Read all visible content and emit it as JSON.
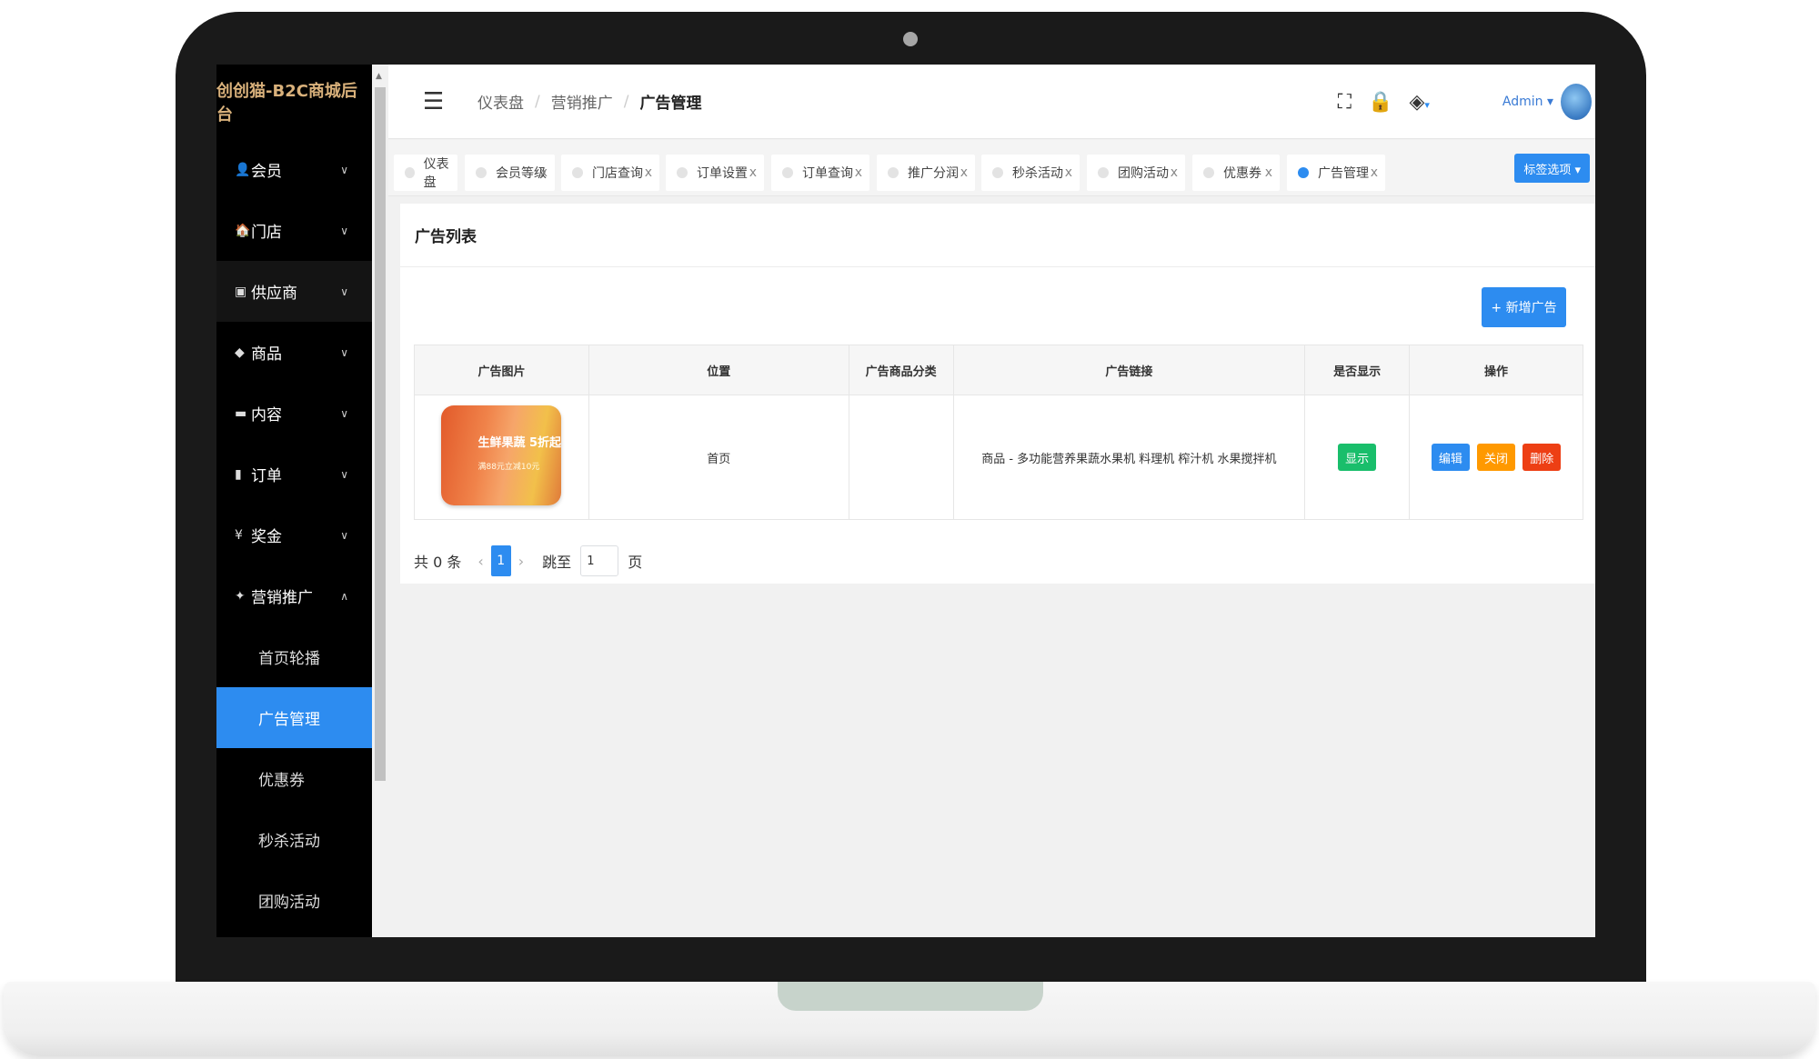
{
  "app": {
    "brand": "创创猫-B2C商城后台"
  },
  "sidebar": {
    "items": [
      {
        "icon": "user-icon",
        "glyph": "👤",
        "label": "会员",
        "arrow": "∨"
      },
      {
        "icon": "store-icon",
        "glyph": "🏠",
        "label": "门店",
        "arrow": "∨"
      },
      {
        "icon": "supplier-icon",
        "glyph": "▣",
        "label": "供应商",
        "arrow": "∨"
      },
      {
        "icon": "tag-icon",
        "glyph": "◆",
        "label": "商品",
        "arrow": "∨"
      },
      {
        "icon": "folder-icon",
        "glyph": "▬",
        "label": "内容",
        "arrow": "∨"
      },
      {
        "icon": "order-icon",
        "glyph": "▮",
        "label": "订单",
        "arrow": "∨"
      },
      {
        "icon": "yen-icon",
        "glyph": "¥",
        "label": "奖金",
        "arrow": "∨"
      },
      {
        "icon": "gamepad-icon",
        "glyph": "✦",
        "label": "营销推广",
        "arrow": "∧"
      }
    ],
    "sub_items": [
      "首页轮播",
      "广告管理",
      "优惠券",
      "秒杀活动",
      "团购活动"
    ]
  },
  "header": {
    "breadcrumb": [
      "仪表盘",
      "营销推广",
      "广告管理"
    ],
    "user": "Admin ▾"
  },
  "tabs": {
    "items": [
      {
        "label": "仪表盘",
        "closable": false
      },
      {
        "label": "会员等级",
        "closable": true
      },
      {
        "label": "门店查询",
        "closable": true
      },
      {
        "label": "订单设置",
        "closable": true
      },
      {
        "label": "订单查询",
        "closable": true
      },
      {
        "label": "推广分润",
        "closable": true
      },
      {
        "label": "秒杀活动",
        "closable": true
      },
      {
        "label": "团购活动",
        "closable": true
      },
      {
        "label": "优惠券",
        "closable": true
      },
      {
        "label": "广告管理",
        "closable": true
      }
    ],
    "close": "x",
    "options_label": "标签选项 ▾"
  },
  "card": {
    "title": "广告列表",
    "add_button": "+ 新增广告"
  },
  "table": {
    "headers": [
      "广告图片",
      "位置",
      "广告商品分类",
      "广告链接",
      "是否显示",
      "操作"
    ],
    "rows": [
      {
        "image_text": "生鲜果蔬 5折起",
        "image_subtext": "满88元立减10元",
        "position": "首页",
        "category": "",
        "link": "商品 - 多功能营养果蔬水果机 料理机 榨汁机 水果搅拌机",
        "display": "显示",
        "actions": [
          "编辑",
          "关闭",
          "删除"
        ]
      }
    ]
  },
  "pager": {
    "total": "共 0 条",
    "prev": "‹",
    "current": "1",
    "next": "›",
    "jump_label": "跳至",
    "jump_value": "1",
    "page_suffix": "页"
  },
  "colors": {
    "primary": "#2d8cf0",
    "success": "#19be6b",
    "warning": "#ff9900",
    "danger": "#ed3f14",
    "brand_text": "#d9b17b"
  }
}
